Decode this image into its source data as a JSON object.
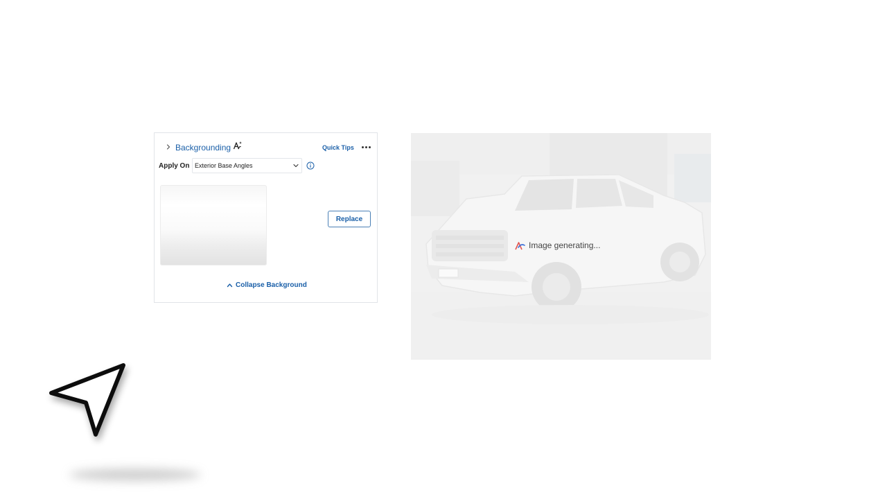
{
  "panel": {
    "title": "Backgrounding",
    "quick_tips": "Quick Tips",
    "apply_label": "Apply On",
    "apply_value": "Exterior Base Angles",
    "replace_label": "Replace",
    "collapse_label": "Collapse Background"
  },
  "preview": {
    "status_text": "Image generating..."
  },
  "colors": {
    "accent": "#1a5fa8",
    "border": "#e1e4e8"
  },
  "icons": {
    "expand": "chevron-right-icon",
    "ai": "ai-sparkle-icon",
    "more": "more-horizontal-icon",
    "info": "info-icon",
    "collapse": "caret-up-icon",
    "cursor": "pointer-arrow-icon"
  }
}
